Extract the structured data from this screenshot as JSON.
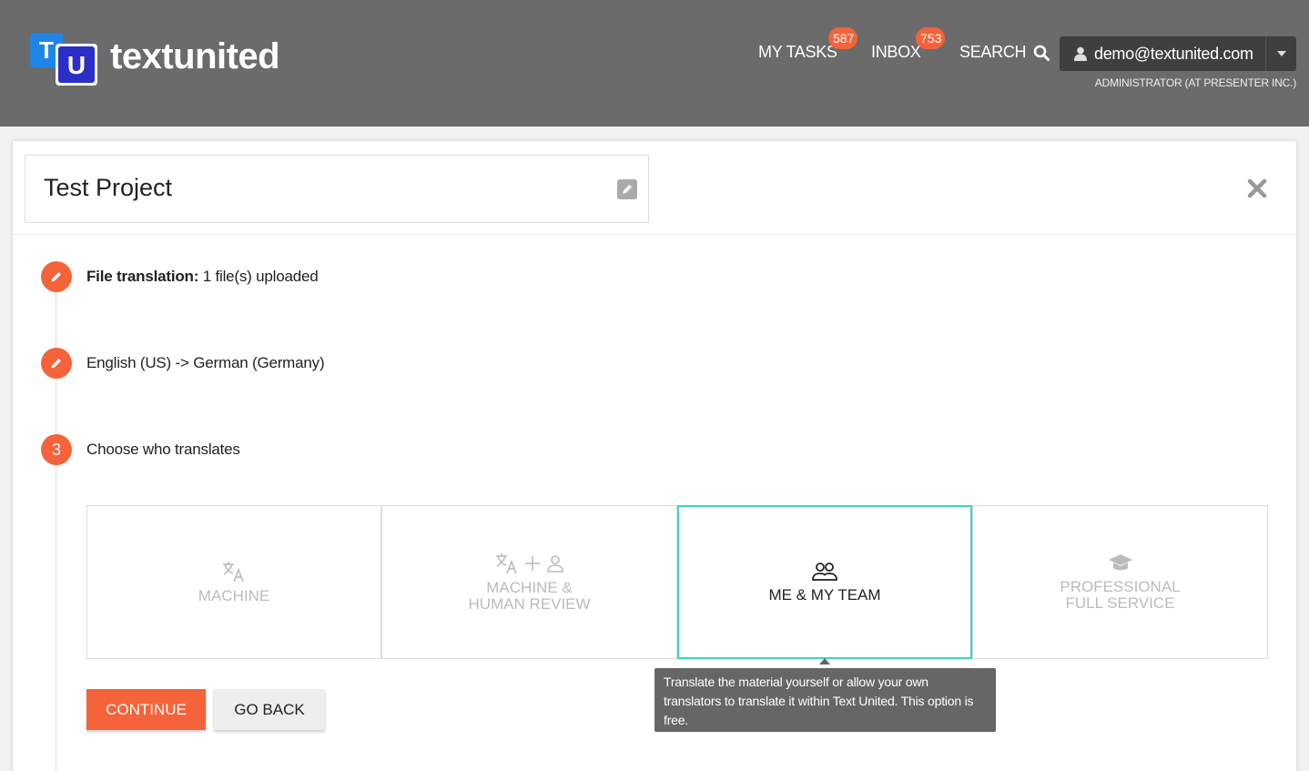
{
  "header": {
    "logo_t": "T",
    "logo_u": "U",
    "brand": "textunited",
    "nav": {
      "tasks_label": "MY TASKS",
      "tasks_count": "587",
      "inbox_label": "INBOX",
      "inbox_count": "753",
      "search_label": "SEARCH"
    },
    "user": {
      "email": "demo@textunited.com",
      "role": "ADMINISTRATOR (AT PRESENTER INC.)"
    }
  },
  "project": {
    "title": "Test Project"
  },
  "steps": [
    {
      "label_bold": "File translation:",
      "label": " 1 file(s) uploaded"
    },
    {
      "label": "English (US) -> German (Germany)"
    },
    {
      "number": "3",
      "label": "Choose who translates"
    }
  ],
  "options": [
    {
      "line1": "MACHINE",
      "line2": "",
      "icon": "translate-icon"
    },
    {
      "line1": "MACHINE &",
      "line2": "HUMAN REVIEW",
      "icon": "translate-plus-person-icon"
    },
    {
      "line1": "ME & MY TEAM",
      "line2": "",
      "icon": "team-icon",
      "selected": true
    },
    {
      "line1": "PROFESSIONAL",
      "line2": "FULL SERVICE",
      "icon": "graduation-cap-icon"
    }
  ],
  "tooltip": "Translate the material yourself or allow your own translators to translate it within Text United. This option is free.",
  "buttons": {
    "continue": "CONTINUE",
    "back": "GO BACK"
  },
  "colors": {
    "accent": "#f4633a",
    "selected_border": "#3dd4c4",
    "header_bg": "#6b6b6b"
  }
}
